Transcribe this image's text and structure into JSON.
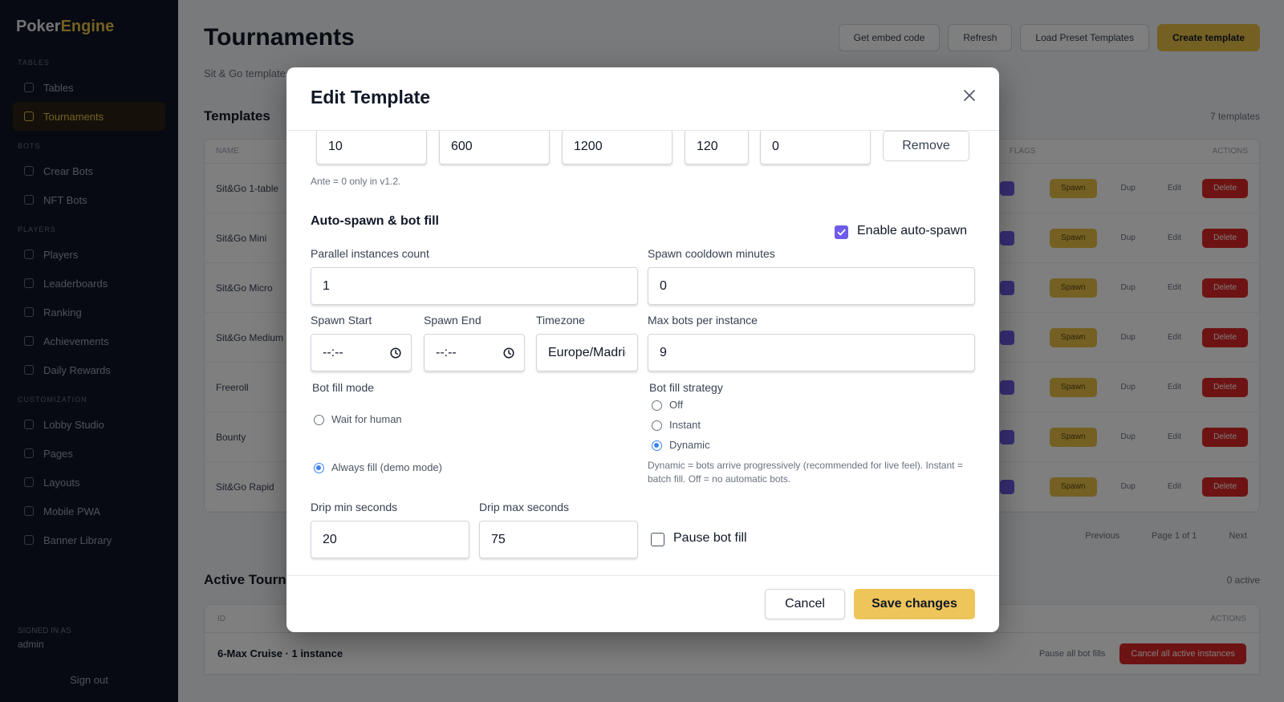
{
  "app": {
    "logo_a": "Poker",
    "logo_b": "Engine",
    "nav_sections": [
      "TABLES",
      "BOTS",
      "PLAYERS",
      "CUSTOMIZATION"
    ],
    "nav_items": [
      "Tables",
      "Tournaments",
      "Crear Bots",
      "NFT Bots",
      "Players",
      "Leaderboards",
      "Ranking",
      "Achievements",
      "Daily Rewards",
      "Lobby Studio",
      "Pages",
      "Layouts",
      "Mobile PWA",
      "Banner Library"
    ],
    "user_label": "SIGNED IN AS",
    "user_name": "admin",
    "sign_out": "Sign out"
  },
  "page": {
    "title": "Tournaments",
    "subtitle": "Sit & Go templates",
    "buttons": {
      "embed": "Get embed code",
      "refresh": "Refresh",
      "load_presets": "Load Preset Templates",
      "create": "Create template"
    },
    "templates_title": "Templates",
    "templates_count": "7 templates",
    "table_headers": {
      "name": "NAME",
      "flags": "FLAGS",
      "actions": "ACTIONS"
    },
    "row_names": [
      "Sit&Go 1-table",
      "Sit&Go Mini",
      "Sit&Go Micro",
      "Sit&Go Medium",
      "Freeroll",
      "Bounty",
      "Sit&Go Rapid"
    ],
    "row_actions": {
      "spawn": "Spawn",
      "dup": "Dup",
      "edit": "Edit",
      "delete": "Delete"
    },
    "pager": {
      "prev": "Previous",
      "page": "Page 1 of 1",
      "next": "Next"
    },
    "active_title": "Active Tournaments",
    "active_count": "0 active",
    "active_header_id": "ID",
    "active_header_actions": "ACTIONS",
    "active_row": "6-Max Cruise · 1 instance",
    "pause_all": "Pause all bot fills",
    "cancel_all": "Cancel all active instances"
  },
  "modal": {
    "title": "Edit Template",
    "blind_level": {
      "level": "10",
      "duration": "600",
      "big_blind": "1200",
      "small_blind": "120",
      "ante": "0",
      "remove_label": "Remove"
    },
    "ante_hint": "Ante = 0 only in v1.2.",
    "autospawn": {
      "section_title": "Auto-spawn & bot fill",
      "enable_label": "Enable auto-spawn",
      "enable_checked": true,
      "parallel_label": "Parallel instances count",
      "parallel_value": "1",
      "cooldown_label": "Spawn cooldown minutes",
      "cooldown_value": "0",
      "spawn_start_label": "Spawn Start",
      "spawn_start_value": "--:--",
      "spawn_end_label": "Spawn End",
      "spawn_end_value": "--:--",
      "timezone_label": "Timezone",
      "timezone_value": "Europe/Madrid",
      "max_bots_label": "Max bots per instance",
      "max_bots_value": "9"
    },
    "bot_fill_mode": {
      "label": "Bot fill mode",
      "options": [
        "Wait for human",
        "Always fill (demo mode)"
      ],
      "selected": "Always fill (demo mode)"
    },
    "bot_fill_strategy": {
      "label": "Bot fill strategy",
      "options": [
        "Off",
        "Instant",
        "Dynamic"
      ],
      "selected": "Dynamic",
      "hint": "Dynamic = bots arrive progressively (recommended for live feel). Instant = batch fill. Off = no automatic bots."
    },
    "drip": {
      "min_label": "Drip min seconds",
      "min_value": "20",
      "max_label": "Drip max seconds",
      "max_value": "75",
      "pause_label": "Pause bot fill",
      "pause_checked": false
    },
    "footer": {
      "cancel_label": "Cancel",
      "save_label": "Save changes"
    }
  },
  "colors": {
    "accent": "#6d5ce8",
    "save": "#eec55a",
    "radio": "#3b82f6",
    "danger": "#dc2626",
    "sidebar": "#0f1524"
  },
  "icons": [
    "close-icon",
    "clock-icon",
    "checkmark-icon"
  ]
}
